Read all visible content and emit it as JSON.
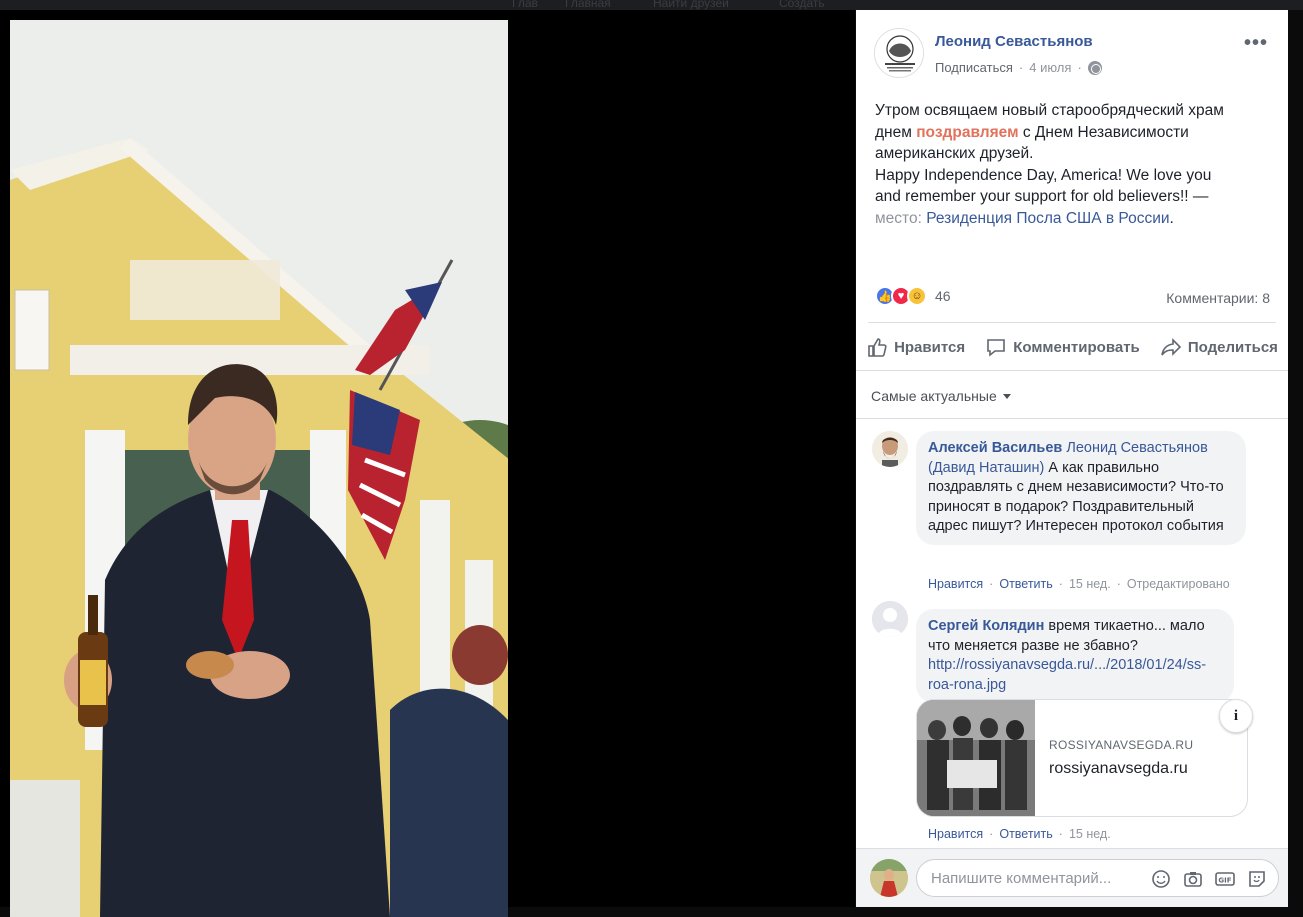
{
  "post": {
    "author": "Леонид Севастьянов",
    "subscribe_label": "Подписаться",
    "time": "4 июля",
    "more": "•••",
    "text_line1": "Утром освящаем новый старообрядческий храм",
    "text_line2_pre": "днем ",
    "text_line2_hl": "поздравляем",
    "text_line2_post": " с Днем Независимости",
    "text_line3": "американских друзей.",
    "text_line4": "Happy Independence Day, America! We love you",
    "text_line5": "and remember your support for old believers!! —",
    "place_prefix": "место: ",
    "place": "Резиденция Посла США в России",
    "place_suffix": "."
  },
  "stats": {
    "reactions_count": "46",
    "comments_label": "Комментарии: 8"
  },
  "actions": {
    "like": "Нравится",
    "comment": "Комментировать",
    "share": "Поделиться"
  },
  "sort": {
    "label": "Самые актуальные"
  },
  "comments": [
    {
      "author": "Алексей Васильев",
      "tag": "Леонид Севастьянов (Давид Наташин)",
      "text": "А как правильно поздравлять с днем независимости? Что-то приносят в подарок? Поздравительный адрес пишут? Интересен протокол события",
      "like": "Нравится",
      "reply": "Ответить",
      "age": "15 нед.",
      "edited": "Отредактировано"
    },
    {
      "author": "Сергей Колядин",
      "text": "время тикаетно... мало что меняется разве не збавно?",
      "url": "http://rossiyanavsegda.ru/.../2018/01/24/ss-roa-rona.jpg",
      "card_domain": "ROSSIYANAVSEGDA.RU",
      "card_title": "rossiyanavsegda.ru",
      "info": "i",
      "like": "Нравится",
      "reply": "Ответить",
      "age": "15 нед."
    }
  ],
  "composer": {
    "placeholder": "Напишите комментарий..."
  },
  "topnav": [
    "Глав",
    "Главная",
    "Найти друзей",
    "Создать"
  ],
  "icons": [
    "globe-icon",
    "like-icon",
    "comment-icon",
    "share-icon",
    "emoji-icon",
    "camera-icon",
    "gif-icon",
    "sticker-icon"
  ],
  "colors": {
    "link": "#385898",
    "highlight": "#e2725b",
    "muted": "#90949c",
    "bubble": "#f2f3f5"
  }
}
